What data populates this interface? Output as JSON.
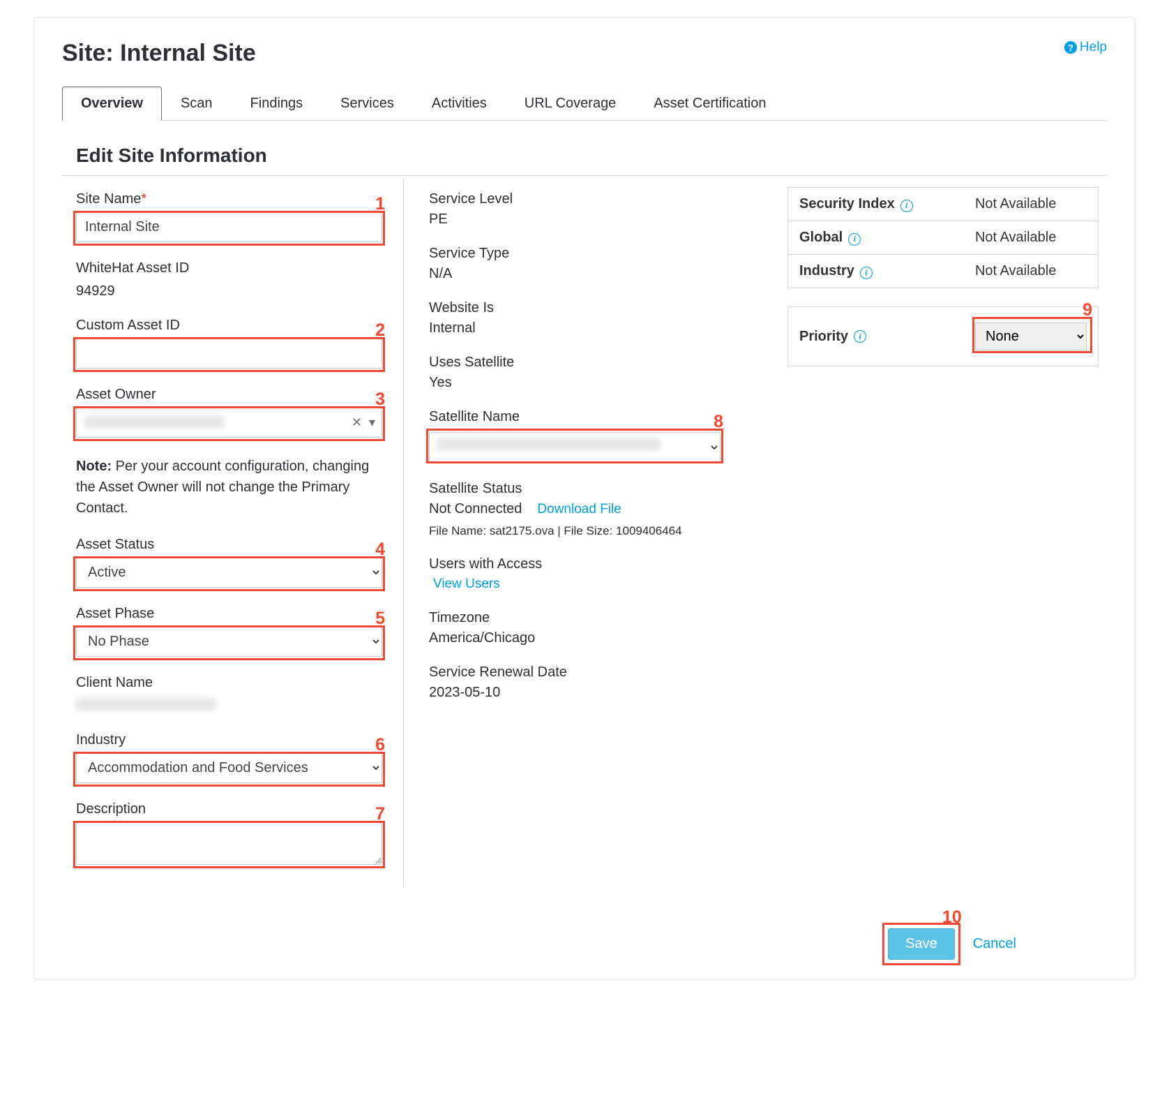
{
  "header": {
    "title": "Site: Internal Site",
    "help": "Help"
  },
  "tabs": [
    "Overview",
    "Scan",
    "Findings",
    "Services",
    "Activities",
    "URL Coverage",
    "Asset Certification"
  ],
  "section_title": "Edit Site Information",
  "left": {
    "site_name_label": "Site Name",
    "site_name_value": "Internal Site",
    "whitehat_id_label": "WhiteHat Asset ID",
    "whitehat_id_value": "94929",
    "custom_id_label": "Custom Asset ID",
    "custom_id_value": "",
    "asset_owner_label": "Asset Owner",
    "asset_owner_value": "",
    "note": "Note:",
    "note_text": " Per your account configuration, changing the Asset Owner will not change the Primary Contact.",
    "asset_status_label": "Asset Status",
    "asset_status_value": "Active",
    "asset_phase_label": "Asset Phase",
    "asset_phase_value": "No Phase",
    "client_name_label": "Client Name",
    "industry_label": "Industry",
    "industry_value": "Accommodation and Food Services",
    "description_label": "Description",
    "description_value": ""
  },
  "mid": {
    "service_level_label": "Service Level",
    "service_level_value": "PE",
    "service_type_label": "Service Type",
    "service_type_value": "N/A",
    "website_is_label": "Website Is",
    "website_is_value": "Internal",
    "uses_satellite_label": "Uses Satellite",
    "uses_satellite_value": "Yes",
    "satellite_name_label": "Satellite Name",
    "satellite_name_value": "",
    "satellite_status_label": "Satellite Status",
    "satellite_status_value": "Not Connected",
    "download_file": "Download File",
    "file_info": "File Name: sat2175.ova | File Size: 1009406464",
    "users_label": "Users with Access",
    "view_users": "View Users",
    "timezone_label": "Timezone",
    "timezone_value": "America/Chicago",
    "renewal_label": "Service Renewal Date",
    "renewal_value": "2023-05-10"
  },
  "right": {
    "security_index_label": "Security Index",
    "security_index_value": "Not Available",
    "global_label": "Global",
    "global_value": "Not Available",
    "industry_label": "Industry",
    "industry_value": "Not Available",
    "priority_label": "Priority",
    "priority_value": "None"
  },
  "actions": {
    "save": "Save",
    "cancel": "Cancel"
  },
  "markers": {
    "1": "1",
    "2": "2",
    "3": "3",
    "4": "4",
    "5": "5",
    "6": "6",
    "7": "7",
    "8": "8",
    "9": "9",
    "10": "10"
  }
}
